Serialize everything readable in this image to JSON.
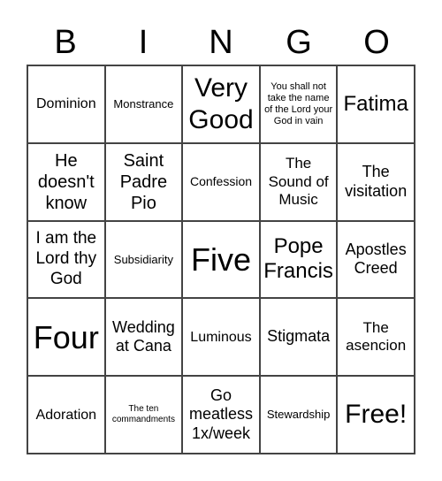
{
  "header": [
    "B",
    "I",
    "N",
    "G",
    "O"
  ],
  "cells": [
    [
      "Dominion",
      "Monstrance",
      "Very Good",
      "You shall not take the name of the Lord your God in vain",
      "Fatima"
    ],
    [
      "He doesn't know",
      "Saint Padre Pio",
      "Confession",
      "The Sound of Music",
      "The visitation"
    ],
    [
      "I am the Lord thy God",
      "Subsidiarity",
      "Five",
      "Pope Francis",
      "Apostles Creed"
    ],
    [
      "Four",
      "Wedding at Cana",
      "Luminous",
      "Stigmata",
      "The asencion"
    ],
    [
      "Adoration",
      "The ten commandments",
      "Go meatless 1x/week",
      "Stewardship",
      "Free!"
    ]
  ]
}
